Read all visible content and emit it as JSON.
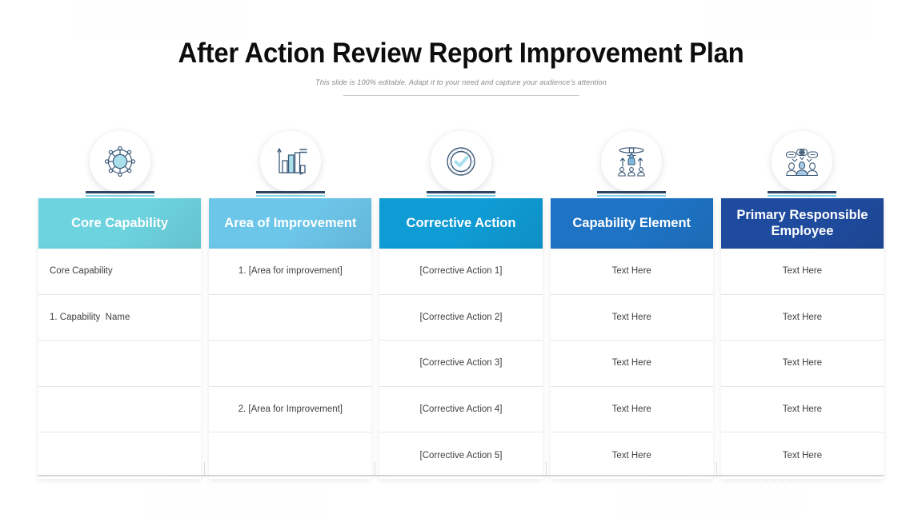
{
  "header": {
    "title": "After Action Review Report Improvement Plan",
    "subtitle": "This slide is 100% editable. Adapt it to your need and capture your audience's attention"
  },
  "theme": {
    "col1_color": "#6DD3DF",
    "col2_color": "#6CC6EA",
    "col3_color": "#0F9BD4",
    "col4_color": "#1E73C4",
    "col5_color": "#1F4B9E",
    "icon_base_color": "#2E4663",
    "icon_accent_color": "#7FD6E6",
    "text_color": "#404040"
  },
  "table": {
    "columns": [
      {
        "header": "Core Capability",
        "icon": "network-hub-icon",
        "align": "left",
        "cells": [
          "Core Capability",
          "1. Capability  Name",
          "",
          "",
          ""
        ]
      },
      {
        "header": "Area of Improvement",
        "icon": "bar-chart-icon",
        "align": "center",
        "cells": [
          "1. [Area for improvement]",
          "",
          "",
          "2. [Area for Improvement]",
          ""
        ]
      },
      {
        "header": "Corrective Action",
        "icon": "check-circle-icon",
        "align": "center",
        "cells": [
          "[Corrective Action 1]",
          "[Corrective Action 2]",
          "[Corrective Action 3]",
          "[Corrective Action 4]",
          "[Corrective Action 5]"
        ]
      },
      {
        "header": "Capability Element",
        "icon": "org-hierarchy-icon",
        "align": "center",
        "cells": [
          "Text Here",
          "Text Here",
          "Text Here",
          "Text Here",
          "Text Here"
        ]
      },
      {
        "header": "Primary Responsible Employee",
        "icon": "team-discussion-icon",
        "align": "center",
        "cells": [
          "Text Here",
          "Text Here",
          "Text Here",
          "Text Here",
          "Text Here"
        ]
      }
    ]
  }
}
